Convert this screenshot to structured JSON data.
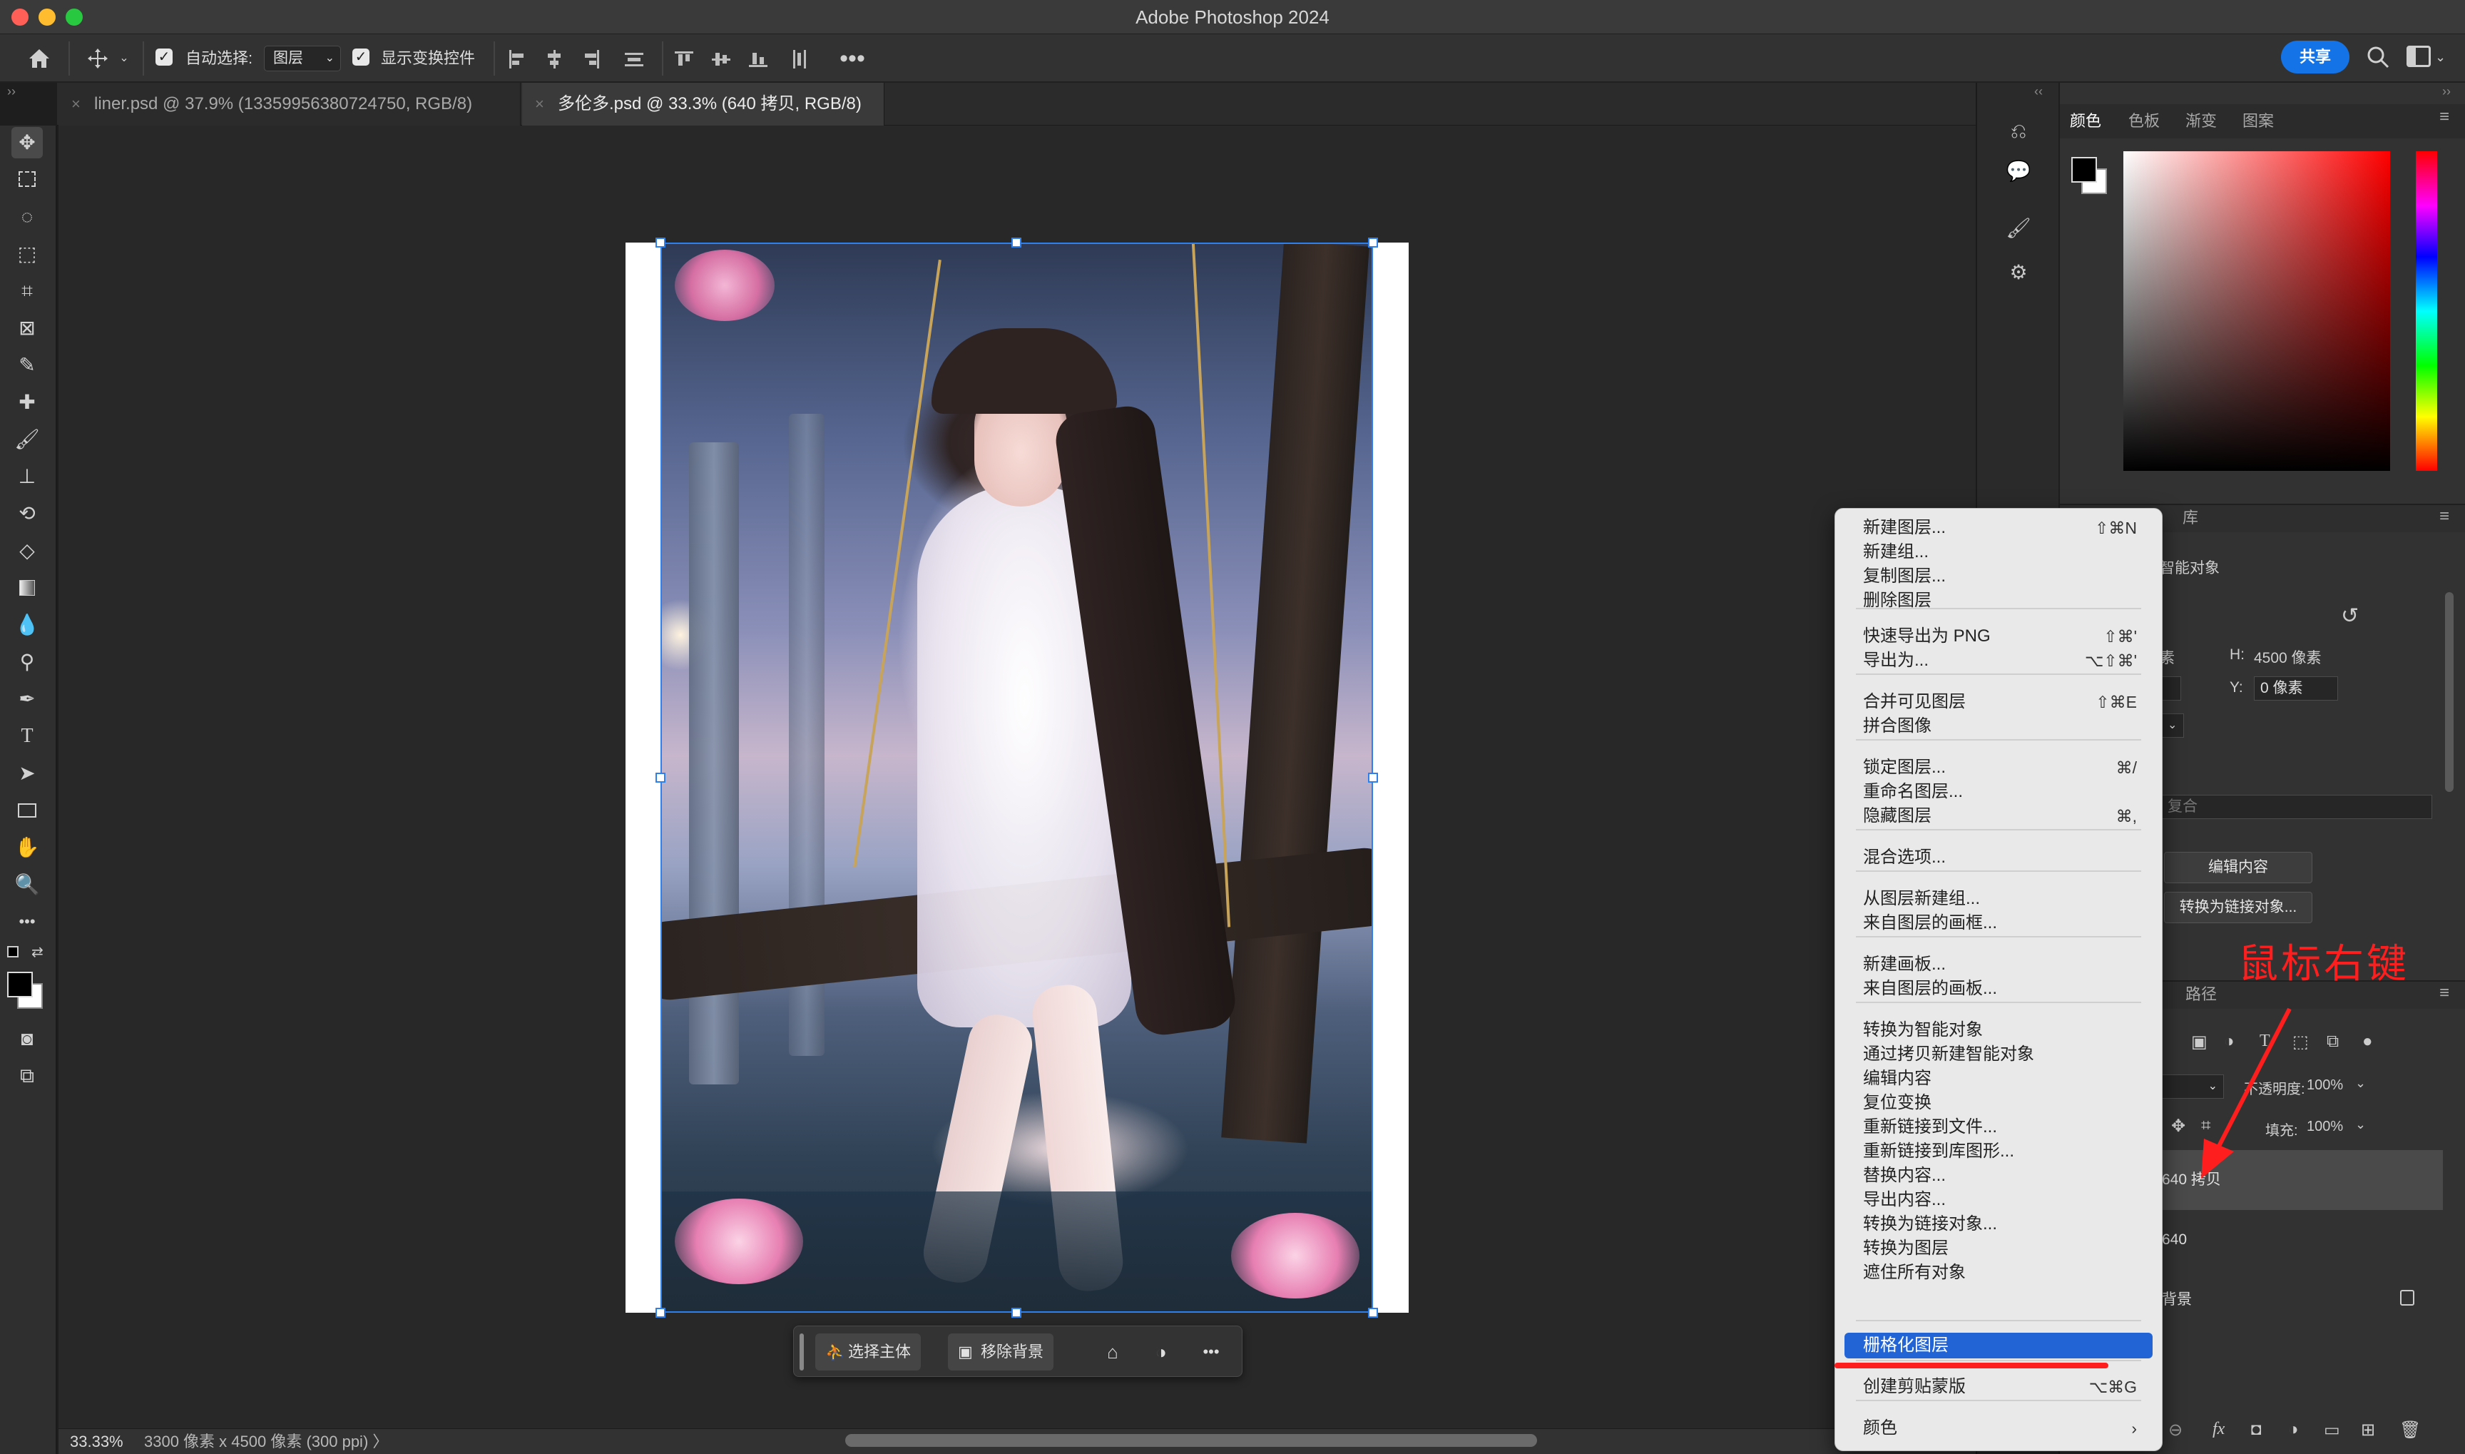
{
  "window": {
    "title": "Adobe Photoshop 2024"
  },
  "options_bar": {
    "auto_select_label": "自动选择:",
    "auto_select_value": "图层",
    "show_transform_label": "显示变换控件",
    "more_icon": "ellipsis-icon",
    "share_label": "共享"
  },
  "tabs": [
    {
      "label": "liner.psd @ 37.9% (13359956380724750, RGB/8)",
      "active": false
    },
    {
      "label": "多伦多.psd @ 33.3% (640 拷贝, RGB/8)",
      "active": true
    }
  ],
  "taskbar": {
    "select_subject": "选择主体",
    "remove_bg": "移除背景"
  },
  "status": {
    "zoom": "33.33%",
    "doc_info": "3300 像素 x 4500 像素 (300 ppi)  〉"
  },
  "color_panel": {
    "tabs": [
      "颜色",
      "色板",
      "渐变",
      "图案"
    ],
    "fg_color": "#000000",
    "bg_color": "#ffffff"
  },
  "properties": {
    "lib_tab": "库",
    "smart_object": "智能对象",
    "w_label_partial": "素",
    "h_label": "H:",
    "h_value": "4500 像素",
    "y_label": "Y:",
    "y_value": "0 像素",
    "blend_partial": "复合",
    "edit_contents": "编辑内容",
    "convert_linked": "转换为链接对象..."
  },
  "layers_panel": {
    "paths_tab": "路径",
    "opacity_label": "不透明度:",
    "opacity_value": "100%",
    "fill_label": "填充:",
    "fill_value": "100%",
    "layers": [
      {
        "name": "640 拷贝",
        "selected": true
      },
      {
        "name": "640",
        "selected": false
      },
      {
        "name": "背景",
        "selected": false,
        "locked": true
      }
    ]
  },
  "context_menu": {
    "groups": [
      [
        {
          "label": "新建图层...",
          "shortcut": "⇧⌘N"
        },
        {
          "label": "新建组...",
          "shortcut": ""
        },
        {
          "label": "复制图层...",
          "shortcut": ""
        },
        {
          "label": "删除图层",
          "shortcut": ""
        }
      ],
      [
        {
          "label": "快速导出为 PNG",
          "shortcut": "⇧⌘'"
        },
        {
          "label": "导出为...",
          "shortcut": "⌥⇧⌘'"
        }
      ],
      [
        {
          "label": "合并可见图层",
          "shortcut": "⇧⌘E"
        },
        {
          "label": "拼合图像",
          "shortcut": ""
        }
      ],
      [
        {
          "label": "锁定图层...",
          "shortcut": "⌘/"
        },
        {
          "label": "重命名图层...",
          "shortcut": ""
        },
        {
          "label": "隐藏图层",
          "shortcut": "⌘,"
        }
      ],
      [
        {
          "label": "混合选项...",
          "shortcut": ""
        }
      ],
      [
        {
          "label": "从图层新建组...",
          "shortcut": ""
        },
        {
          "label": "来自图层的画框...",
          "shortcut": ""
        }
      ],
      [
        {
          "label": "新建画板...",
          "shortcut": ""
        },
        {
          "label": "来自图层的画板...",
          "shortcut": ""
        }
      ],
      [
        {
          "label": "转换为智能对象",
          "shortcut": ""
        },
        {
          "label": "通过拷贝新建智能对象",
          "shortcut": ""
        },
        {
          "label": "编辑内容",
          "shortcut": ""
        },
        {
          "label": "复位变换",
          "shortcut": ""
        },
        {
          "label": "重新链接到文件...",
          "shortcut": ""
        },
        {
          "label": "重新链接到库图形...",
          "shortcut": ""
        },
        {
          "label": "替换内容...",
          "shortcut": ""
        },
        {
          "label": "导出内容...",
          "shortcut": ""
        },
        {
          "label": "转换为链接对象...",
          "shortcut": ""
        },
        {
          "label": "转换为图层",
          "shortcut": ""
        },
        {
          "label": "遮住所有对象",
          "shortcut": ""
        }
      ],
      [
        {
          "label": "栅格化图层",
          "shortcut": "",
          "highlighted": true
        }
      ],
      [
        {
          "label": "创建剪贴蒙版",
          "shortcut": "⌥⌘G"
        }
      ],
      [
        {
          "label": "颜色",
          "shortcut": "›"
        }
      ]
    ]
  },
  "annotation": {
    "text": "鼠标右键",
    "color": "#ff1e1e"
  },
  "accent_color": "#1473e6"
}
